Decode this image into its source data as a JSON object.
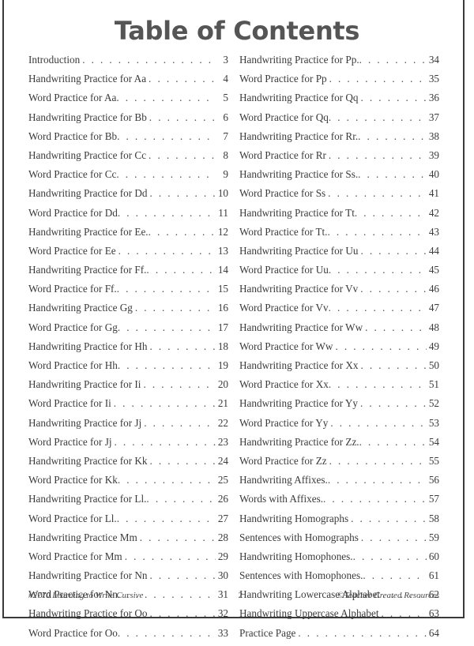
{
  "document": {
    "title": "Table of Contents",
    "page_number": "2"
  },
  "toc": {
    "left_column": [
      {
        "title": "Introduction",
        "leader": ". . . . . . . . . . . . . . . . . . . . . . . . .",
        "page": "3",
        "tight": false
      },
      {
        "title": "Handwriting Practice for Aa",
        "leader": ". . . . . . . . . . . . . .",
        "page": "4",
        "tight": false
      },
      {
        "title": "Word Practice for Aa",
        "leader": ". . . . . . . . . . . . . . . . . . . .",
        "page": "5",
        "tight": true
      },
      {
        "title": "Handwriting Practice for Bb",
        "leader": ". . . . . . . . . . . . . .",
        "page": "6",
        "tight": false
      },
      {
        "title": "Word Practice for Bb",
        "leader": ". . . . . . . . . . . . . . . . . . . . .",
        "page": "7",
        "tight": true
      },
      {
        "title": "Handwriting Practice for Cc",
        "leader": ". . . . . . . . . . . . . .",
        "page": "8",
        "tight": false
      },
      {
        "title": "Word Practice for Cc",
        "leader": ". . . . . . . . . . . . . . . . . . . .",
        "page": "9",
        "tight": true
      },
      {
        "title": "Handwriting Practice for Dd",
        "leader": ". . . . . . . . . . . . .",
        "page": "10",
        "tight": false
      },
      {
        "title": "Word Practice for Dd",
        "leader": ". . . . . . . . . . . . . . . . . . .",
        "page": "11",
        "tight": true
      },
      {
        "title": "Handwriting Practice for Ee.",
        "leader": ". . . . . . . . . . . . .",
        "page": "12",
        "tight": true
      },
      {
        "title": "Word Practice for Ee",
        "leader": ". . . . . . . . . . . . . . . . . . .",
        "page": "13",
        "tight": false
      },
      {
        "title": "Handwriting Practice for Ff.",
        "leader": ". . . . . . . . . . . . .",
        "page": "14",
        "tight": true
      },
      {
        "title": "Word Practice for Ff.",
        "leader": ". . . . . . . . . . . . . . . . . . .",
        "page": "15",
        "tight": true
      },
      {
        "title": "Handwriting Practice Gg",
        "leader": ". . . . . . . . . . . . . . . .",
        "page": "16",
        "tight": false
      },
      {
        "title": "Word Practice for Gg",
        "leader": ". . . . . . . . . . . . . . . . . . .",
        "page": "17",
        "tight": true
      },
      {
        "title": "Handwriting Practice for Hh",
        "leader": ". . . . . . . . . . . . .",
        "page": "18",
        "tight": false
      },
      {
        "title": "Word Practice for Hh",
        "leader": ". . . . . . . . . . . . . . . . . . .",
        "page": "19",
        "tight": true
      },
      {
        "title": "Handwriting Practice for Ii",
        "leader": ". . . . . . . . . . . . . . .",
        "page": "20",
        "tight": false
      },
      {
        "title": "Word Practice for Ii",
        "leader": ". . . . . . . . . . . . . . . . . . . .",
        "page": "21",
        "tight": false
      },
      {
        "title": "Handwriting Practice for Jj",
        "leader": ". . . . . . . . . . . . . .",
        "page": "22",
        "tight": false
      },
      {
        "title": "Word Practice for Jj",
        "leader": ". . . . . . . . . . . . . . . . . . . .",
        "page": "23",
        "tight": false
      },
      {
        "title": "Handwriting Practice for Kk",
        "leader": ". . . . . . . . . . . . .",
        "page": "24",
        "tight": false
      },
      {
        "title": "Word Practice for Kk",
        "leader": ". . . . . . . . . . . . . . . . . . .",
        "page": "25",
        "tight": true
      },
      {
        "title": "Handwriting Practice for Ll.",
        "leader": ". . . . . . . . . . . . .",
        "page": "26",
        "tight": true
      },
      {
        "title": "Word Practice for Ll.",
        "leader": ". . . . . . . . . . . . . . . . . . .",
        "page": "27",
        "tight": true
      },
      {
        "title": "Handwriting Practice Mm",
        "leader": ". . . . . . . . . . . . . . .",
        "page": "28",
        "tight": false
      },
      {
        "title": "Word Practice for Mm",
        "leader": ". . . . . . . . . . . . . . . . . .",
        "page": "29",
        "tight": false
      },
      {
        "title": "Handwriting Practice for Nn",
        "leader": ". . . . . . . . . . . . .",
        "page": "30",
        "tight": false
      },
      {
        "title": "Word Practice for Nn",
        "leader": ". . . . . . . . . . . . . . . . . . .",
        "page": "31",
        "tight": true
      },
      {
        "title": "Handwriting Practice for Oo",
        "leader": ". . . . . . . . . . . . .",
        "page": "32",
        "tight": false
      },
      {
        "title": "Word Practice for Oo",
        "leader": ". . . . . . . . . . . . . . . . . . .",
        "page": "33",
        "tight": true
      }
    ],
    "right_column": [
      {
        "title": "Handwriting Practice for Pp.",
        "leader": ". . . . . . . . . . . . . .",
        "page": "34",
        "tight": true
      },
      {
        "title": "Word Practice for Pp",
        "leader": ". . . . . . . . . . . . . . . . . . . .",
        "page": "35",
        "tight": false
      },
      {
        "title": "Handwriting Practice for Qq",
        "leader": ". . . . . . . . . . . . .",
        "page": "36",
        "tight": false
      },
      {
        "title": "Word Practice for Qq",
        "leader": ". . . . . . . . . . . . . . . . . . .",
        "page": "37",
        "tight": true
      },
      {
        "title": "Handwriting Practice for Rr.",
        "leader": ". . . . . . . . . . . . . .",
        "page": "38",
        "tight": true
      },
      {
        "title": "Word Practice for Rr",
        "leader": ". . . . . . . . . . . . . . . . . . . .",
        "page": "39",
        "tight": false
      },
      {
        "title": "Handwriting Practice for Ss.",
        "leader": ". . . . . . . . . . . . . .",
        "page": "40",
        "tight": true
      },
      {
        "title": "Word Practice for Ss",
        "leader": ". . . . . . . . . . . . . . . . . . .",
        "page": "41",
        "tight": false
      },
      {
        "title": "Handwriting Practice for Tt",
        "leader": ". . . . . . . . . . . . . .",
        "page": "42",
        "tight": true
      },
      {
        "title": "Word Practice for Tt.",
        "leader": ". . . . . . . . . . . . . . . . . . .",
        "page": "43",
        "tight": true
      },
      {
        "title": "Handwriting Practice for Uu",
        "leader": ". . . . . . . . . . . . .",
        "page": "44",
        "tight": false
      },
      {
        "title": "Word Practice for Uu",
        "leader": ". . . . . . . . . . . . . . . . . . .",
        "page": "45",
        "tight": true
      },
      {
        "title": "Handwriting Practice for Vv",
        "leader": ". . . . . . . . . . . . .",
        "page": "46",
        "tight": false
      },
      {
        "title": "Word Practice for Vv",
        "leader": ". . . . . . . . . . . . . . . . . . .",
        "page": "47",
        "tight": true
      },
      {
        "title": "Handwriting Practice for Ww",
        "leader": ". . . . . . . . . . . .",
        "page": "48",
        "tight": false
      },
      {
        "title": "Word Practice for Ww",
        "leader": ". . . . . . . . . . . . . . . . . .",
        "page": "49",
        "tight": false
      },
      {
        "title": "Handwriting Practice for Xx",
        "leader": ". . . . . . . . . . . . . .",
        "page": "50",
        "tight": false
      },
      {
        "title": "Word Practice for Xx",
        "leader": ". . . . . . . . . . . . . . . . . . .",
        "page": "51",
        "tight": true
      },
      {
        "title": "Handwriting Practice for Yy",
        "leader": ". . . . . . . . . . . . .",
        "page": "52",
        "tight": false
      },
      {
        "title": "Word Practice for Yy",
        "leader": ". . . . . . . . . . . . . . . . . . .",
        "page": "53",
        "tight": false
      },
      {
        "title": "Handwriting Practice for Zz.",
        "leader": ". . . . . . . . . . . . .",
        "page": "54",
        "tight": true
      },
      {
        "title": "Word Practice for Zz",
        "leader": ". . . . . . . . . . . . . . . . . . .",
        "page": "55",
        "tight": false
      },
      {
        "title": "Handwriting Affixes.",
        "leader": ". . . . . . . . . . . . . . . . . . . .",
        "page": "56",
        "tight": true
      },
      {
        "title": "Words with Affixes.",
        "leader": ". . . . . . . . . . . . . . . . . . . .",
        "page": "57",
        "tight": true
      },
      {
        "title": "Handwriting Homographs",
        "leader": ". . . . . . . . . . . . . . .",
        "page": "58",
        "tight": false
      },
      {
        "title": "Sentences with Homographs",
        "leader": ". . . . . . . . . . . . .",
        "page": "59",
        "tight": false
      },
      {
        "title": "Handwriting Homophones.",
        "leader": ". . . . . . . . . . . . . .",
        "page": "60",
        "tight": true
      },
      {
        "title": "Sentences with Homophones.",
        "leader": ". . . . . . . . . . . .",
        "page": "61",
        "tight": true
      },
      {
        "title": "Handwriting Lowercase Alphabet",
        "leader": ". . . . . . . . .",
        "page": "62",
        "tight": false
      },
      {
        "title": "Handwriting Uppercase Alphabet",
        "leader": ". . . . . . . . .",
        "page": "63",
        "tight": false
      },
      {
        "title": "Practice Page",
        "leader": ". . . . . . . . . . . . . . . . . . . . . . .",
        "page": "64",
        "tight": false
      }
    ]
  },
  "footer": {
    "left": "#2770 Learning to Write Cursive",
    "center": "2",
    "right": "©Teacher Created Resources"
  }
}
